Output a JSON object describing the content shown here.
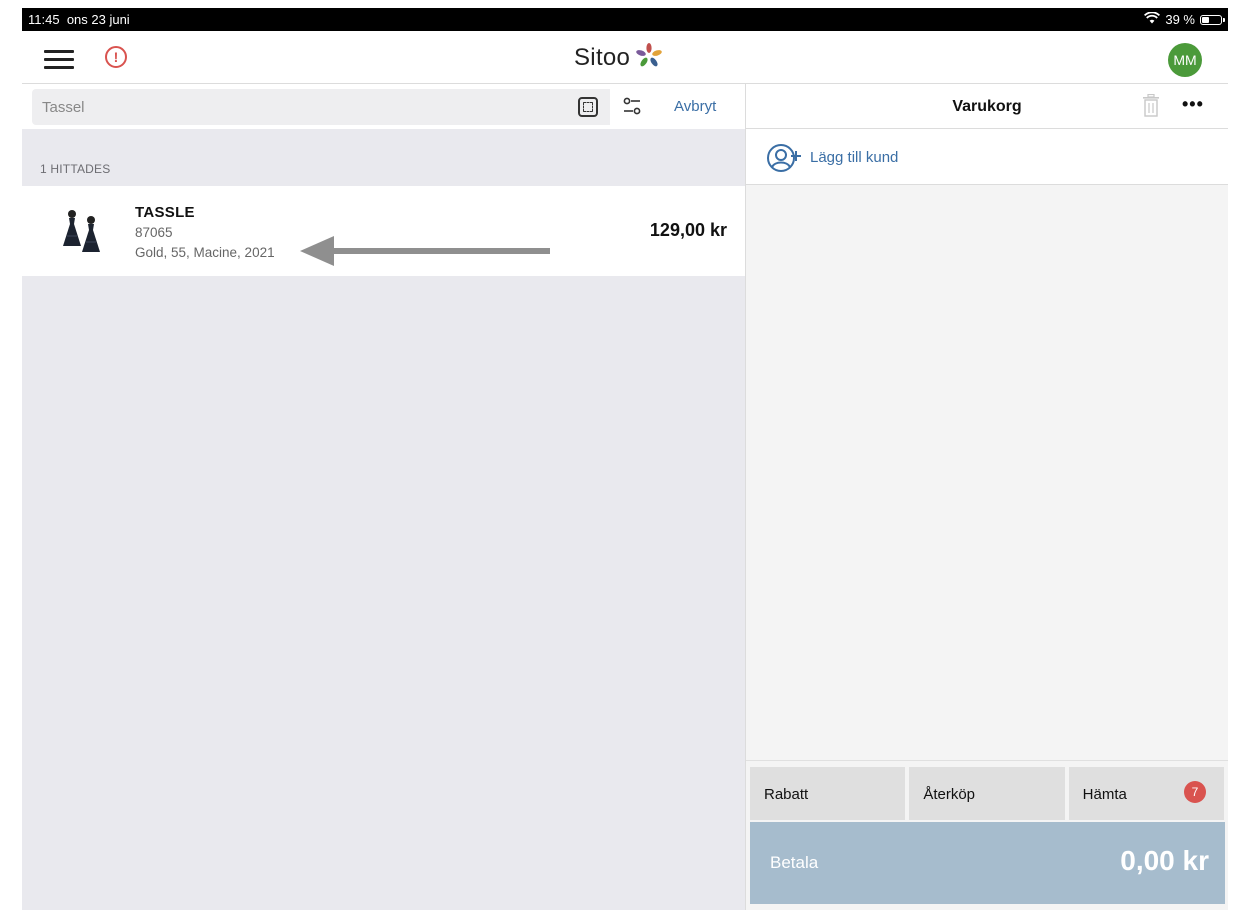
{
  "status_bar": {
    "time": "11:45",
    "date": "ons 23 juni",
    "battery": "39 %",
    "battery_level": 0.39
  },
  "header": {
    "brand": "Sitoo",
    "user_initials": "MM"
  },
  "search": {
    "value": "Tassel",
    "cancel_label": "Avbryt"
  },
  "results": {
    "count_label": "1 HITTADES",
    "items": [
      {
        "name": "TASSLE",
        "sku": "87065",
        "attributes": "Gold, 55, Macine, 2021",
        "price": "129,00 kr"
      }
    ]
  },
  "cart": {
    "title": "Varukorg",
    "add_customer_label": "Lägg till kund",
    "actions": [
      {
        "label": "Rabatt"
      },
      {
        "label": "Återköp"
      },
      {
        "label": "Hämta",
        "badge": "7"
      }
    ],
    "pay_label": "Betala",
    "total": "0,00 kr"
  },
  "colors": {
    "accent": "#3a6ea5",
    "alert": "#d9534f",
    "avatar": "#4b9a3a",
    "pay": "#a6bccd"
  }
}
